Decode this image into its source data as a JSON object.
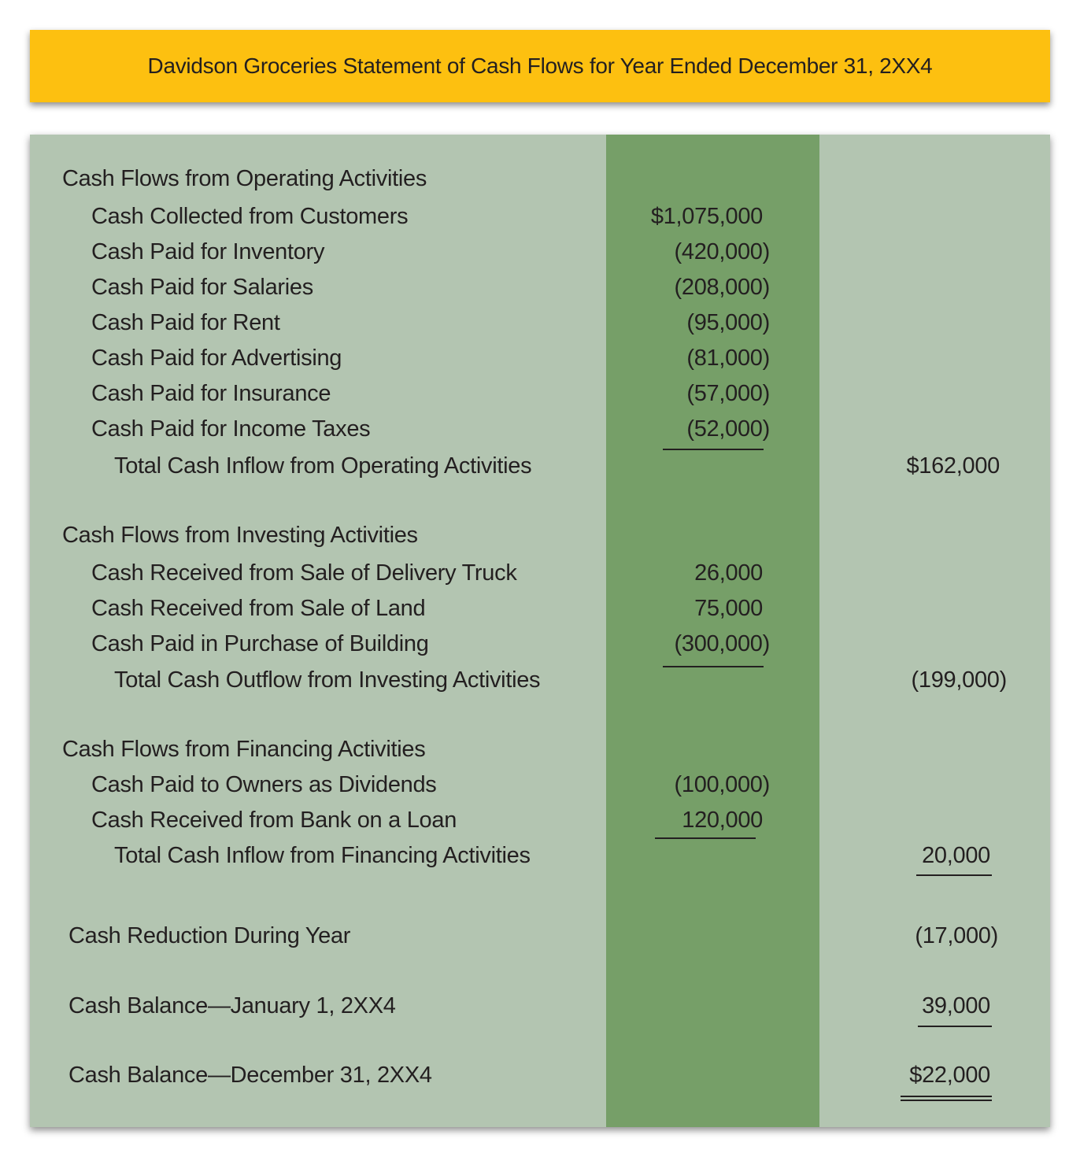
{
  "title": "Davidson Groceries Statement of Cash Flows for Year Ended December 31, 2XX4",
  "colors": {
    "title_bar": "#fdc010",
    "panel": "#b3c5b1",
    "middle_column": "#769f68",
    "text": "#231f20"
  },
  "operating": {
    "heading": "Cash Flows from Operating Activities",
    "items": [
      {
        "label": "Cash Collected from Customers",
        "amount": "$1,075,000"
      },
      {
        "label": "Cash Paid for Inventory",
        "amount": "(420,000)"
      },
      {
        "label": "Cash Paid for Salaries",
        "amount": "(208,000)"
      },
      {
        "label": "Cash Paid for Rent",
        "amount": "(95,000)"
      },
      {
        "label": "Cash Paid for Advertising",
        "amount": "(81,000)"
      },
      {
        "label": "Cash Paid for Insurance",
        "amount": "(57,000)"
      },
      {
        "label": "Cash Paid for Income Taxes",
        "amount": "(52,000)"
      }
    ],
    "total_label": "Total Cash Inflow from Operating Activities",
    "total_amount": "$162,000"
  },
  "investing": {
    "heading": "Cash Flows from Investing Activities",
    "items": [
      {
        "label": "Cash Received from Sale of Delivery Truck",
        "amount": "26,000"
      },
      {
        "label": "Cash Received from Sale of Land",
        "amount": "75,000"
      },
      {
        "label": "Cash Paid in Purchase of Building",
        "amount": "(300,000)"
      }
    ],
    "total_label": "Total Cash Outflow from Investing Activities",
    "total_amount": "(199,000)"
  },
  "financing": {
    "heading": "Cash Flows from Financing Activities",
    "items": [
      {
        "label": "Cash Paid to Owners as Dividends",
        "amount": "(100,000)"
      },
      {
        "label": "Cash Received from Bank on a Loan",
        "amount": "120,000"
      }
    ],
    "total_label": "Total Cash Inflow from Financing Activities",
    "total_amount": "20,000"
  },
  "summary": [
    {
      "label": "Cash Reduction During Year",
      "amount": "(17,000)"
    },
    {
      "label": "Cash Balance—January 1, 2XX4",
      "amount": "39,000"
    },
    {
      "label": "Cash Balance—December 31, 2XX4",
      "amount": "$22,000"
    }
  ]
}
